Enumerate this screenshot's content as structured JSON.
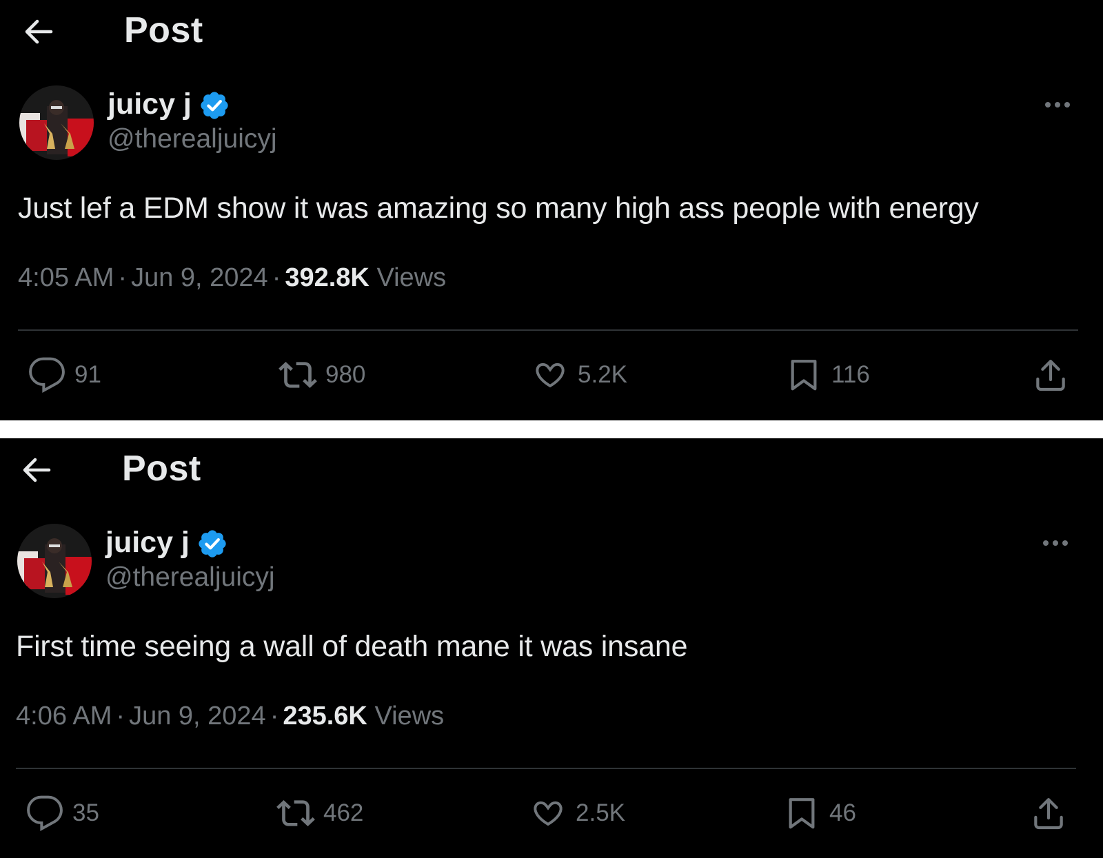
{
  "posts": [
    {
      "header_title": "Post",
      "author_name": "juicy j",
      "author_handle": "@therealjuicyj",
      "text": "Just lef a EDM show it was amazing so many high ass people with energy",
      "time": "4:05 AM",
      "date": "Jun 9, 2024",
      "views_count": "392.8K",
      "views_label": "Views",
      "replies": "91",
      "reposts": "980",
      "likes": "5.2K",
      "bookmarks": "116"
    },
    {
      "header_title": "Post",
      "author_name": "juicy j",
      "author_handle": "@therealjuicyj",
      "text": "First time seeing a wall of death mane it was insane",
      "time": "4:06 AM",
      "date": "Jun 9, 2024",
      "views_count": "235.6K",
      "views_label": "Views",
      "replies": "35",
      "reposts": "462",
      "likes": "2.5K",
      "bookmarks": "46"
    }
  ],
  "colors": {
    "background": "#000000",
    "text_primary": "#e7e9ea",
    "text_secondary": "#71767b",
    "verified_badge": "#1d9bf0",
    "divider": "#2f3336",
    "separator_strip": "#ffffff"
  },
  "icons": [
    "back-arrow-icon",
    "verified-badge-icon",
    "more-options-icon",
    "reply-icon",
    "repost-icon",
    "like-icon",
    "bookmark-icon",
    "share-icon"
  ]
}
